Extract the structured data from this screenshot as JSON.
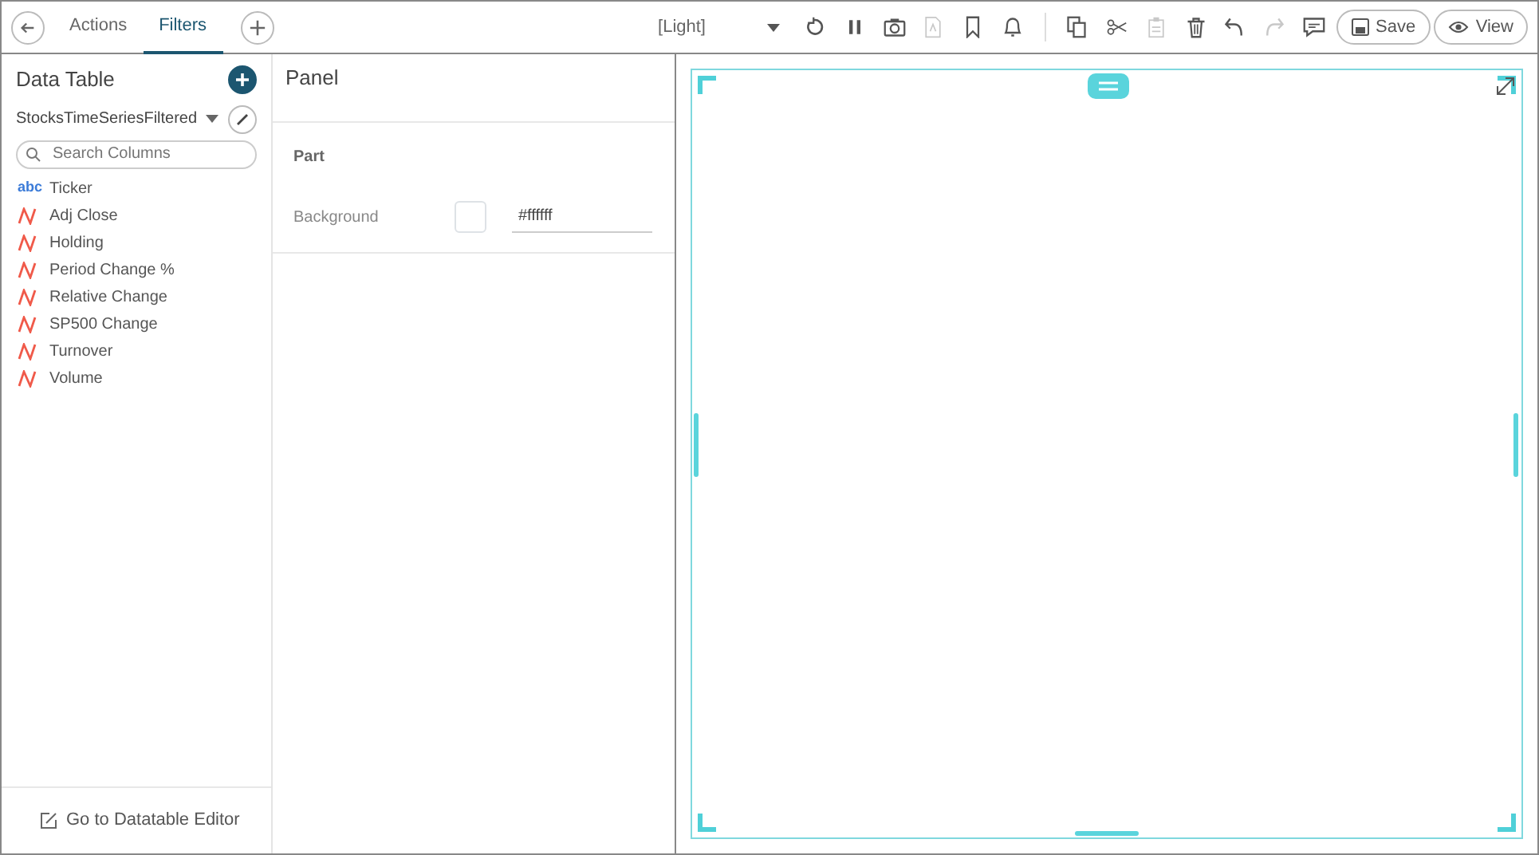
{
  "tabs": [
    {
      "label": "Actions",
      "selected": false
    },
    {
      "label": "Filters",
      "selected": true
    }
  ],
  "theme_select": {
    "value": "[Light]"
  },
  "toolbar": [
    {
      "kind": "refresh",
      "disabled": false
    },
    {
      "kind": "pause",
      "disabled": false
    },
    {
      "kind": "camera",
      "disabled": false
    },
    {
      "kind": "pdf",
      "disabled": true
    },
    {
      "kind": "bookmark",
      "disabled": false
    },
    {
      "kind": "bell",
      "disabled": false
    },
    {
      "kind": "separator"
    },
    {
      "kind": "copy",
      "disabled": false
    },
    {
      "kind": "cut",
      "disabled": false
    },
    {
      "kind": "paste",
      "disabled": true
    },
    {
      "kind": "delete",
      "disabled": false
    },
    {
      "kind": "undo",
      "disabled": false
    },
    {
      "kind": "redo",
      "disabled": true
    },
    {
      "kind": "comment",
      "disabled": false
    }
  ],
  "save_button": {
    "label": "Save"
  },
  "view_button": {
    "label": "View"
  },
  "data_table": {
    "title": "Data Table",
    "dataset": "StocksTimeSeriesFiltered",
    "search": {
      "placeholder": "Search Columns"
    },
    "columns": [
      {
        "name": "Ticker",
        "kind": "text",
        "type_label": "abc"
      },
      {
        "name": "Adj Close",
        "kind": "numeric"
      },
      {
        "name": "Holding",
        "kind": "numeric"
      },
      {
        "name": "Period Change %",
        "kind": "numeric"
      },
      {
        "name": "Relative Change",
        "kind": "numeric"
      },
      {
        "name": "SP500 Change",
        "kind": "numeric"
      },
      {
        "name": "Turnover",
        "kind": "numeric"
      },
      {
        "name": "Volume",
        "kind": "numeric"
      }
    ],
    "footer_link": "Go to Datatable Editor"
  },
  "panel": {
    "title": "Panel",
    "section": "Part",
    "background_label": "Background",
    "background_value": "#ffffff"
  }
}
